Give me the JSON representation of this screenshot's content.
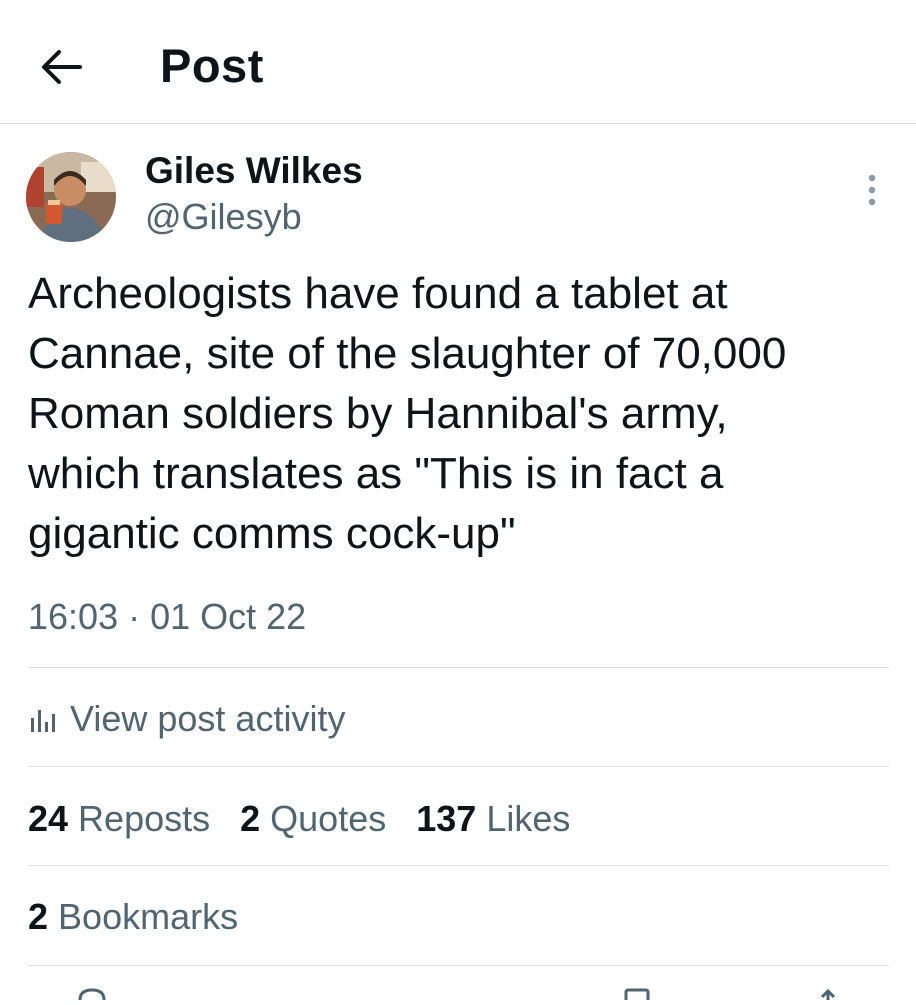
{
  "header": {
    "title": "Post",
    "back_icon": "arrow-left-icon"
  },
  "post": {
    "author": {
      "name": "Giles Wilkes",
      "handle": "@Gilesyb",
      "avatar_icon": "avatar-photo"
    },
    "text": "Archeologists have found a tablet at\nCannae, site of the slaughter of 70,000\nRoman soldiers by Hannibal's army,\nwhich translates as \"This is in fact a\ngigantic comms cock-up\"",
    "timestamp": "16:03 · 01 Oct 22",
    "activity_label": "View post activity",
    "stats": {
      "reposts_count": "24",
      "reposts_label": "Reposts",
      "quotes_count": "2",
      "quotes_label": "Quotes",
      "likes_count": "137",
      "likes_label": "Likes",
      "bookmarks_count": "2",
      "bookmarks_label": "Bookmarks"
    }
  },
  "colors": {
    "text_primary": "#0f1419",
    "text_secondary": "#536471",
    "divider": "#dcdfe2",
    "background": "#ffffff"
  }
}
